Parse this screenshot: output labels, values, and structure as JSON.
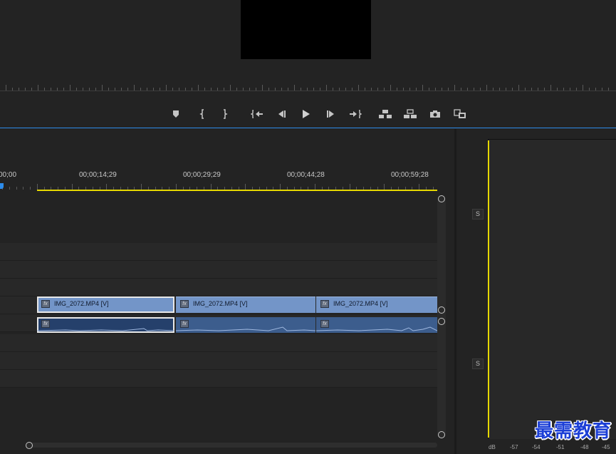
{
  "monitor": {
    "transport_buttons": [
      {
        "name": "add-marker-button",
        "icon": "marker-icon"
      },
      {
        "name": "mark-in-button",
        "icon": "mark-in-icon"
      },
      {
        "name": "mark-out-button",
        "icon": "mark-out-icon"
      },
      {
        "name": "go-to-in-button",
        "icon": "go-to-in-icon"
      },
      {
        "name": "step-back-button",
        "icon": "step-back-icon"
      },
      {
        "name": "play-button",
        "icon": "play-icon"
      },
      {
        "name": "step-forward-button",
        "icon": "step-forward-icon"
      },
      {
        "name": "go-to-out-button",
        "icon": "go-to-out-icon"
      },
      {
        "name": "lift-button",
        "icon": "lift-icon"
      },
      {
        "name": "extract-button",
        "icon": "extract-icon"
      },
      {
        "name": "export-frame-button",
        "icon": "camera-icon"
      },
      {
        "name": "comparison-view-button",
        "icon": "compare-icon"
      }
    ]
  },
  "timeline": {
    "timecodes": [
      "00;00",
      "00;00;14;29",
      "00;00;29;29",
      "00;00;44;28",
      "00;00;59;28"
    ],
    "video_clips": [
      {
        "label": "IMG_2072.MP4 [V]",
        "selected": true
      },
      {
        "label": "IMG_2072.MP4 [V]",
        "selected": false
      },
      {
        "label": "IMG_2072.MP4 [V]",
        "selected": false
      }
    ],
    "fx_badge": "fx",
    "solo_label": "S"
  },
  "meters": {
    "db_label": "dB",
    "scale": [
      "-57",
      "-54",
      "-51",
      "-48",
      "-45"
    ]
  },
  "watermark": "最需教育",
  "colors": {
    "accent_blue": "#2d8ceb",
    "work_area_yellow": "#e6d800",
    "video_clip": "#7395c8",
    "audio_clip": "#3c5d8d"
  }
}
